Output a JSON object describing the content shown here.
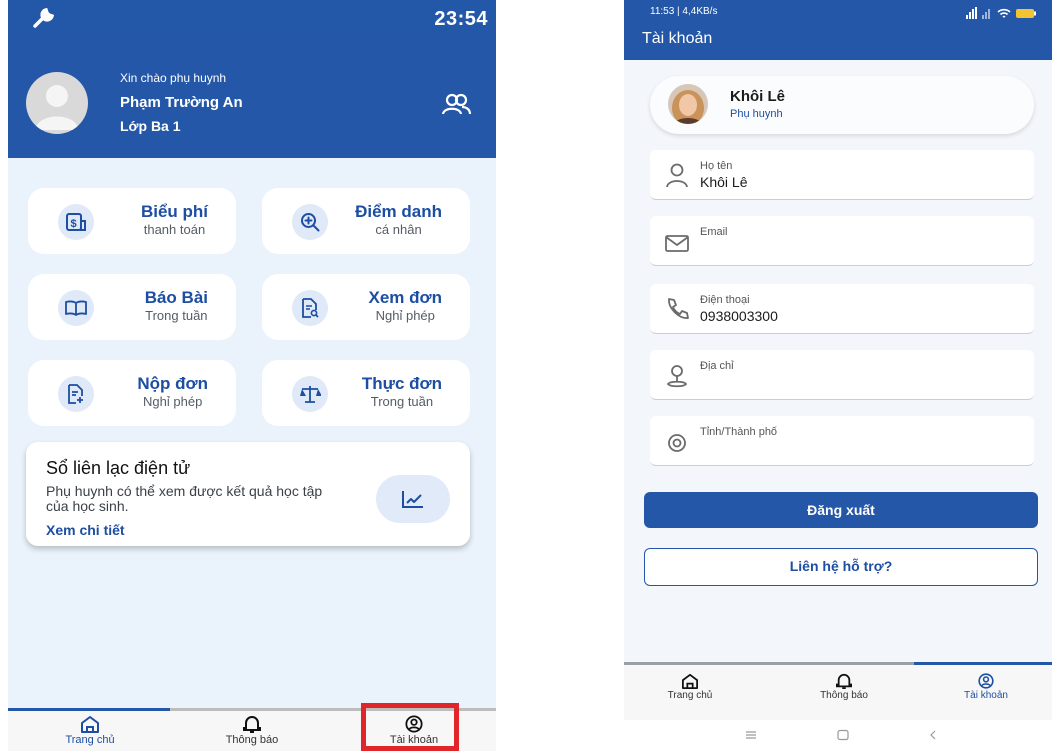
{
  "left": {
    "status": {
      "time": "23:54"
    },
    "header": {
      "greeting": "Xin chào phụ huynh",
      "name": "Phạm Trường An",
      "class_name": "Lớp Ba 1"
    },
    "cards": [
      {
        "title": "Biểu phí",
        "subtitle": "thanh toán"
      },
      {
        "title": "Điểm danh",
        "subtitle": "cá nhân"
      },
      {
        "title": "Báo Bài",
        "subtitle": "Trong tuần"
      },
      {
        "title": "Xem đơn",
        "subtitle": "Nghỉ phép"
      },
      {
        "title": "Nộp đơn",
        "subtitle": "Nghỉ phép"
      },
      {
        "title": "Thực đơn",
        "subtitle": "Trong tuần"
      }
    ],
    "contact_book": {
      "title": "Sổ liên lạc điện tử",
      "description": "Phụ huynh có thể xem được kết quả học tập của học sinh.",
      "link": "Xem chi tiết"
    },
    "nav": [
      "Trang chủ",
      "Thông báo",
      "Tài khoản"
    ]
  },
  "right": {
    "status": {
      "text": "11:53 | 4,4KB/s"
    },
    "title": "Tài khoản",
    "profile": {
      "name": "Khôi Lê",
      "role": "Phụ huynh"
    },
    "fields": [
      {
        "label": "Họ tên",
        "value": "Khôi Lê"
      },
      {
        "label": "Email",
        "value": ""
      },
      {
        "label": "Điện thoại",
        "value": "0938003300"
      },
      {
        "label": "Địa chỉ",
        "value": ""
      },
      {
        "label": "Tỉnh/Thành phố",
        "value": ""
      }
    ],
    "logout": "Đăng xuất",
    "support": "Liên hệ hỗ trợ?",
    "nav": [
      "Trang chủ",
      "Thông báo",
      "Tài khoản"
    ]
  },
  "colors": {
    "primary": "#2457a7",
    "highlight": "#e1262b"
  }
}
